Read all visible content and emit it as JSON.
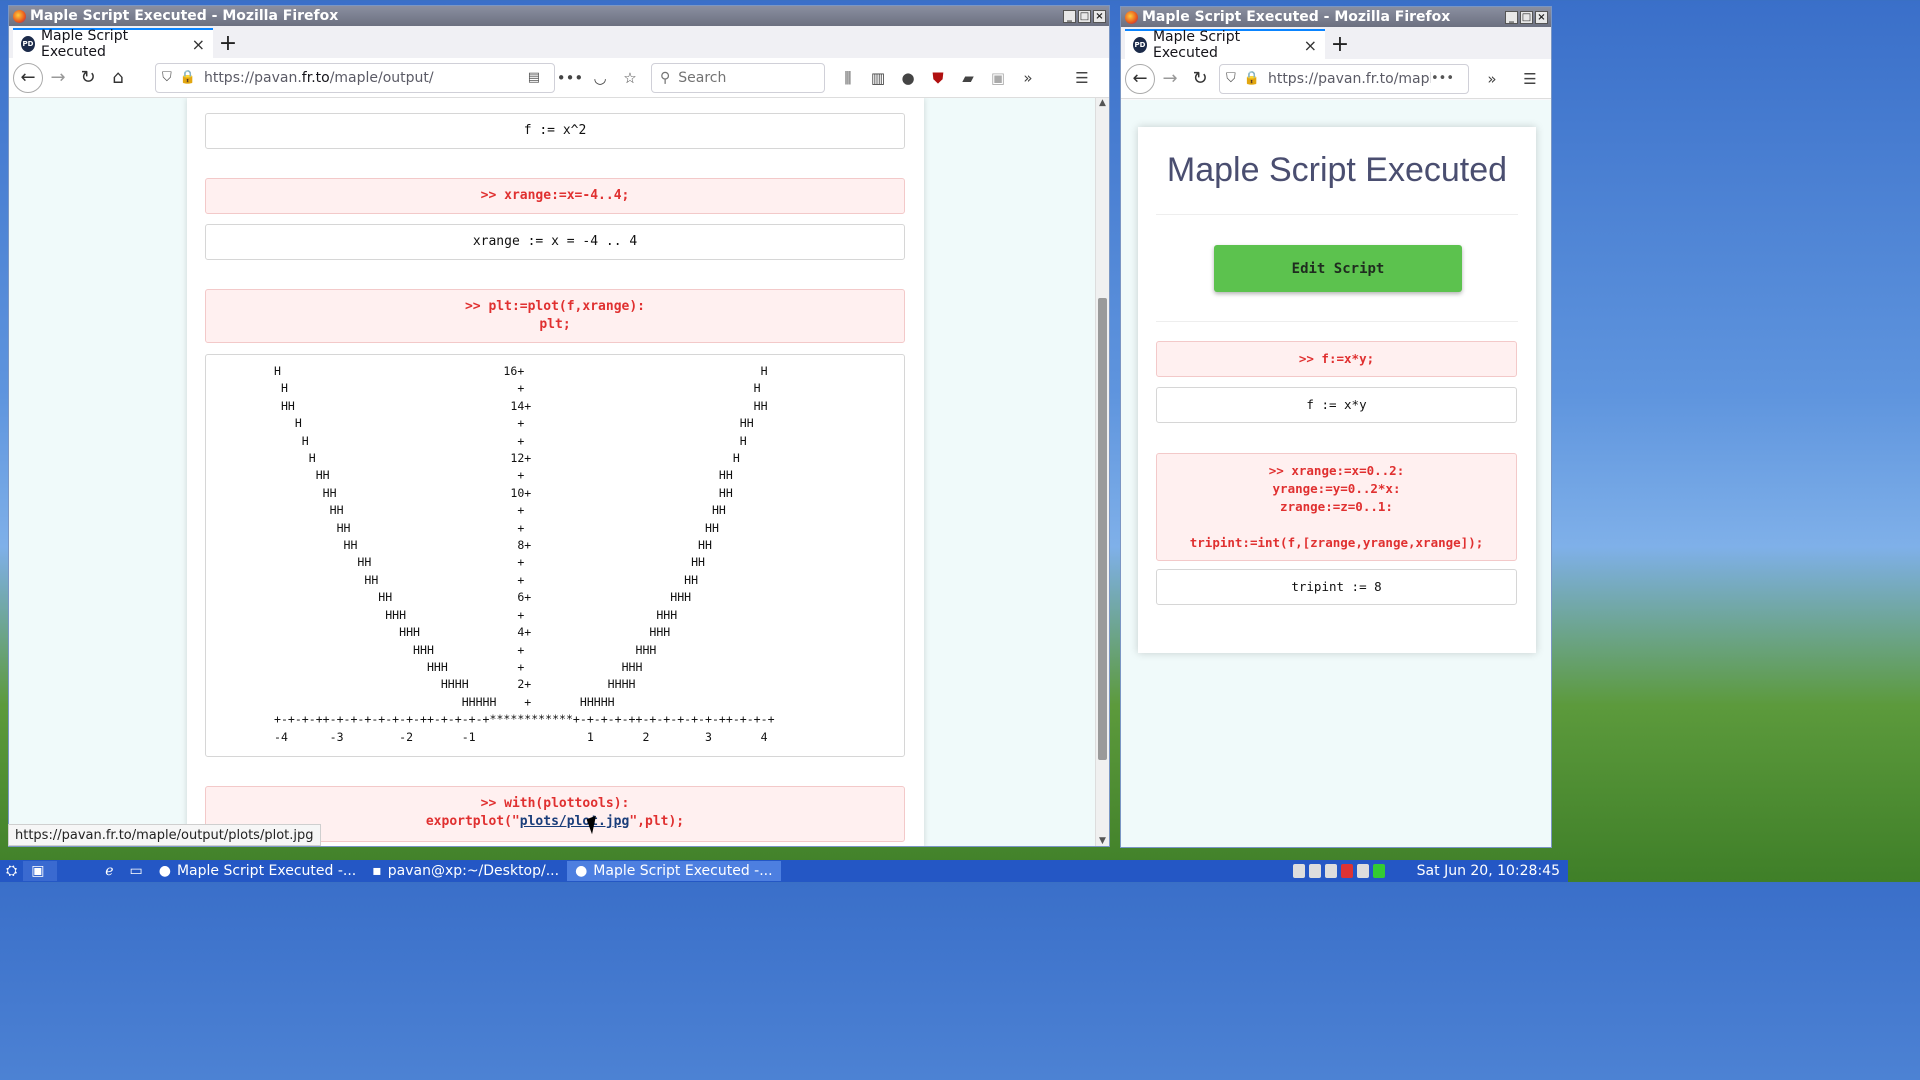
{
  "left_window": {
    "title": "Maple Script Executed - Mozilla Firefox",
    "tab_title": "Maple Script Executed",
    "url_prefix": "https://pavan.",
    "url_domain": "fr.to",
    "url_suffix": "/maple/output/",
    "search_placeholder": "Search",
    "blocks": {
      "f_output": "f := x^2",
      "xrange_input": ">> xrange:=x=-4..4;",
      "xrange_output": "xrange := x = -4 .. 4",
      "plot_input": ">> plt:=plot(f,xrange):\nplt;",
      "export_input_line1": ">> with(plottools):",
      "export_input_prefix": "exportplot(\"",
      "export_input_link": "plots/plot.jpg",
      "export_input_suffix": "\",plt);"
    },
    "ascii_plot": "H                                16+                                  H\n H                                 +                                 H\n HH                               14+                                HH\n   H                               +                               HH\n    H                              +                               H\n     H                            12+                             H\n      HH                           +                            HH\n       HH                         10+                           HH\n        HH                         +                           HH\n         HH                        +                          HH\n          HH                       8+                        HH\n            HH                     +                        HH\n             HH                    +                       HH\n               HH                  6+                    HHH\n                HHH                +                   HHH\n                  HHH              4+                 HHH\n                    HHH            +                HHH\n                      HHH          +              HHH\n                        HHHH       2+           HHHH\n                           HHHHH    +       HHHHH\n+-+-+-++-+-+-+-+-+-+-++-+-+-+-+************+-+-+-+-++-+-+-+-+-+-++-+-+-+\n-4      -3        -2       -1                1       2        3       4",
    "status_url": "https://pavan.fr.to/maple/output/plots/plot.jpg"
  },
  "right_window": {
    "title": "Maple Script Executed - Mozilla Firefox",
    "tab_title": "Maple Script Executed",
    "url": "https://pavan.fr.to/maple",
    "heading": "Maple Script Executed",
    "edit_button": "Edit Script",
    "blocks": {
      "f_input": ">> f:=x*y;",
      "f_output": "f := x*y",
      "tripint_input": ">> xrange:=x=0..2:\nyrange:=y=0..2*x:\nzrange:=z=0..1:\n\ntripint:=int(f,[zrange,yrange,xrange]);",
      "tripint_output": "tripint := 8"
    }
  },
  "taskbar": {
    "tasks": [
      "Maple Script Executed -...",
      "pavan@xp:~/Desktop/...",
      "Maple Script Executed -..."
    ],
    "clock": "Sat Jun 20, 10:28:45"
  },
  "colors": {
    "input_text": "#e03030",
    "edit_button": "#5cc24e",
    "taskbar": "#2457c5"
  }
}
